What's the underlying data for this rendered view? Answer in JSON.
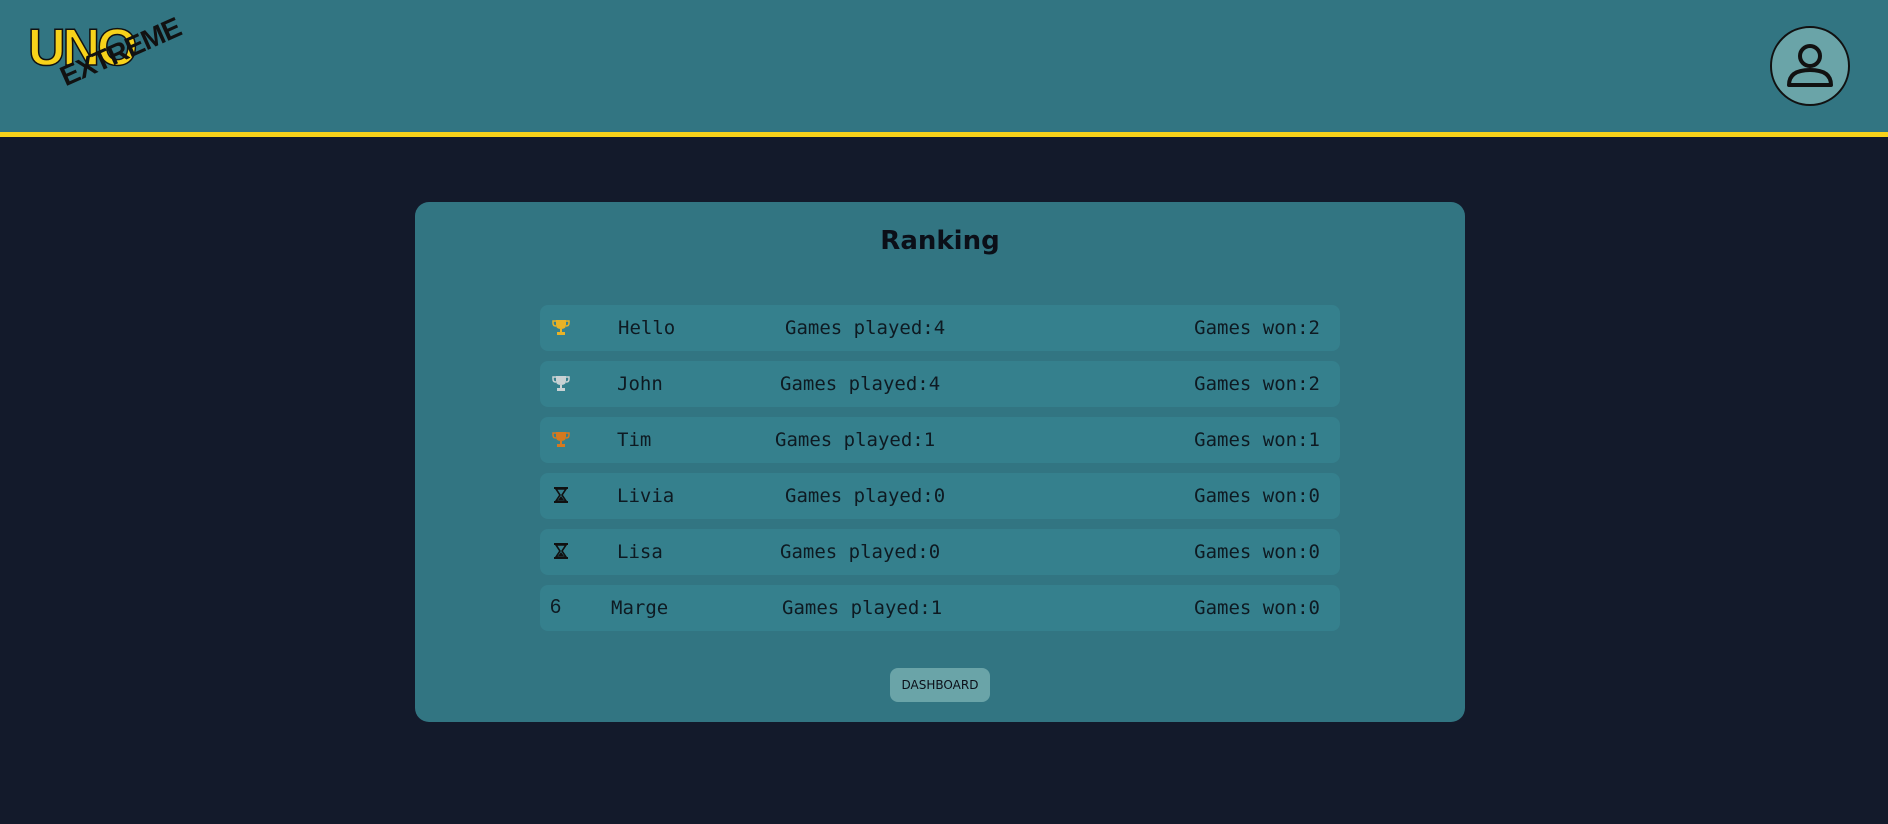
{
  "header": {
    "logo_top": "UNO",
    "logo_bottom": "EXTREME",
    "avatar_icon": "user-profile-icon",
    "bar_color": "#327582",
    "accent_color": "#f7d21a"
  },
  "ranking": {
    "title": "Ranking",
    "rows": [
      {
        "rank_icon": "trophy-gold-icon",
        "rank_label": "",
        "name": "Hello",
        "played": "Games played:4",
        "won": "Games won:2"
      },
      {
        "rank_icon": "trophy-silver-icon",
        "rank_label": "",
        "name": "John",
        "played": "Games played:4",
        "won": "Games won:2"
      },
      {
        "rank_icon": "trophy-bronze-icon",
        "rank_label": "",
        "name": "Tim",
        "played": "Games played:1",
        "won": "Games won:1"
      },
      {
        "rank_icon": "hourglass-icon",
        "rank_label": "",
        "name": "Livia",
        "played": "Games played:0",
        "won": "Games won:0"
      },
      {
        "rank_icon": "hourglass-icon",
        "rank_label": "",
        "name": "Lisa",
        "played": "Games played:0",
        "won": "Games won:0"
      },
      {
        "rank_icon": "",
        "rank_label": "6",
        "name": "Marge",
        "played": "Games played:1",
        "won": "Games won:0"
      }
    ],
    "colors": {
      "gold": "#e8b226",
      "silver": "#c9d2d4",
      "bronze": "#d6791f"
    }
  },
  "dashboard_button": "DASHBOARD"
}
